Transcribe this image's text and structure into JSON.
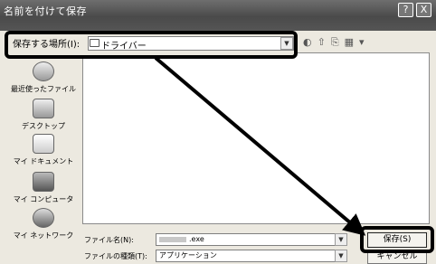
{
  "window": {
    "title": "名前を付けて保存",
    "help_button": "?",
    "close_button": "X"
  },
  "save_in": {
    "label": "保存する場所(I):",
    "value": "ドライバー"
  },
  "toolbar": {
    "icons": [
      "back-icon",
      "up-folder-icon",
      "new-folder-icon",
      "view-menu-icon"
    ]
  },
  "places": [
    {
      "label": "最近使ったファイル",
      "icon": "recent-icon"
    },
    {
      "label": "デスクトップ",
      "icon": "desktop-icon"
    },
    {
      "label": "マイ ドキュメント",
      "icon": "my-documents-icon"
    },
    {
      "label": "マイ コンピュータ",
      "icon": "my-computer-icon"
    },
    {
      "label": "マイ ネットワーク",
      "icon": "my-network-icon"
    }
  ],
  "file_name": {
    "label": "ファイル名(N):",
    "value": ".exe"
  },
  "file_type": {
    "label": "ファイルの種類(T):",
    "value": "アプリケーション"
  },
  "buttons": {
    "save": "保存(S)",
    "cancel": "キャンセル"
  },
  "colors": {
    "dialog_bg": "#ece9e0",
    "highlight_frame": "#000000"
  }
}
